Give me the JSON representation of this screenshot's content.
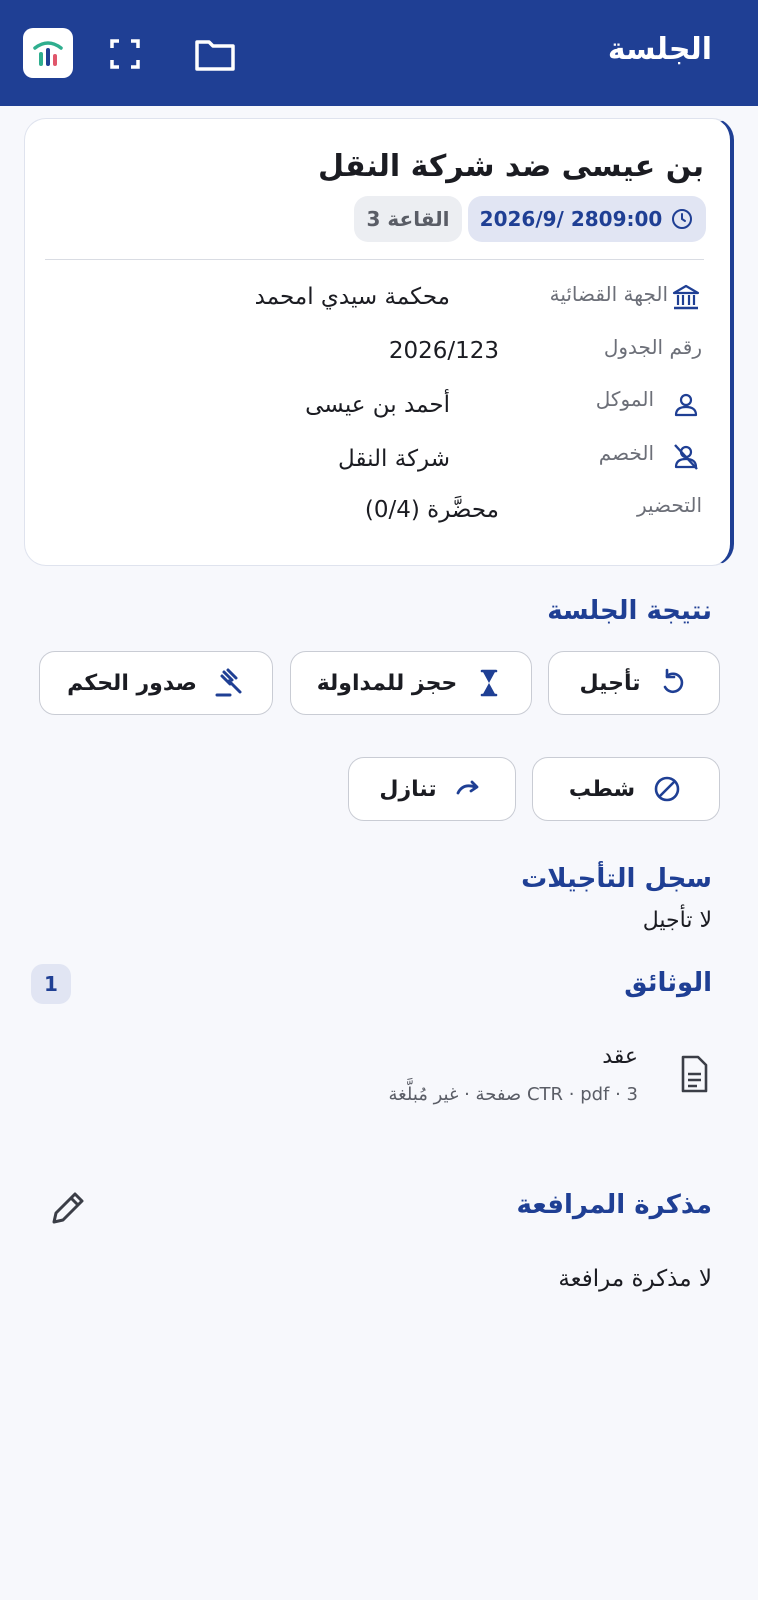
{
  "header": {
    "title": "الجلسة",
    "icons": [
      "app-logo",
      "fullscreen-icon",
      "folder-icon"
    ],
    "background": "#1f3f94"
  },
  "hearing": {
    "title": "بن عيسى ضد شركة النقل",
    "datetime": "2026/9/ 2809:00",
    "room": "القاعة 3",
    "fields": {
      "court": {
        "label": "الجهة القضائية",
        "value": "محكمة سيدي امحمد"
      },
      "docket": {
        "label": "رقم الجدول",
        "value": "2026/123"
      },
      "client": {
        "label": "الموكل",
        "value": "أحمد بن عيسى"
      },
      "opponent": {
        "label": "الخصم",
        "value": "شركة النقل"
      },
      "preparation": {
        "label": "التحضير",
        "value": "محضَّرة (0/4)"
      }
    }
  },
  "outcome": {
    "title": "نتيجة الجلسة",
    "buttons": {
      "postpone": "تأجيل",
      "deliberation": "حجز للمداولة",
      "verdict": "صدور الحكم",
      "strike": "شطب",
      "waiver": "تنازل"
    }
  },
  "postponements": {
    "title": "سجل التأجيلات",
    "empty": "لا تأجيل"
  },
  "documents": {
    "title": "الوثائق",
    "count": "1",
    "items": [
      {
        "name": "عقد",
        "meta": "CTR · pdf · 3 صفحة · غير مُبلَّغة"
      }
    ]
  },
  "memo": {
    "title": "مذكرة المرافعة",
    "empty": "لا مذكرة مرافعة"
  },
  "colors": {
    "accent": "#1f3f94",
    "chip_bg": "#e1e5f3",
    "page_bg": "#f7f8fc"
  }
}
